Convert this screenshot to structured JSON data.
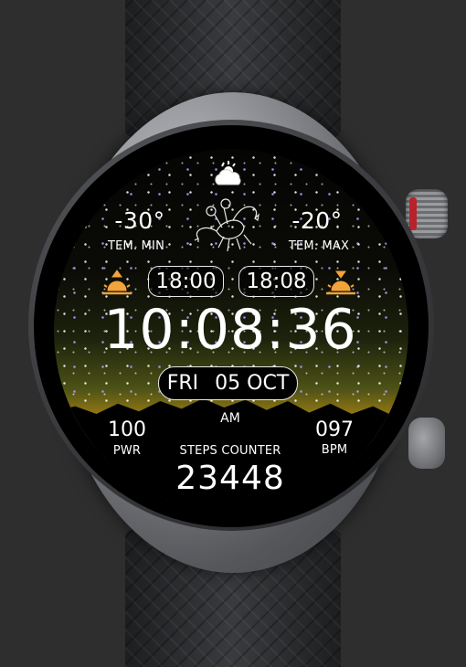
{
  "colors": {
    "background": "#2e2e2e",
    "sun_icon": "#f2a33a",
    "crown_accent": "#b8232b",
    "text": "#ffffff"
  },
  "weather": {
    "icon": "cloud-sun-icon"
  },
  "zodiac": {
    "icon": "scorpion-icon"
  },
  "temperature": {
    "min_value": "-30°",
    "min_label": "TEM. MIN",
    "max_value": "-20°",
    "max_label": "TEM. MAX"
  },
  "sun": {
    "sunrise_icon": "sunrise-icon",
    "sunrise_time": "18:00",
    "sunset_icon": "sunset-icon",
    "sunset_time": "18:08"
  },
  "clock": {
    "time": "10:08:36",
    "weekday": "FRI",
    "date": "05 OCT",
    "ampm": "AM"
  },
  "stats": {
    "battery_value": "100",
    "battery_label": "PWR",
    "steps_label": "STEPS COUNTER",
    "steps_value": "23448",
    "heart_value": "097",
    "heart_label": "BPM"
  }
}
